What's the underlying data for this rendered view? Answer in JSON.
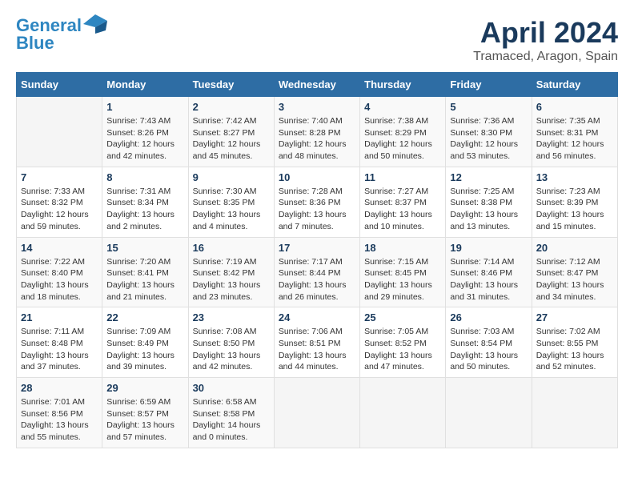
{
  "header": {
    "logo_line1": "General",
    "logo_line2": "Blue",
    "month_year": "April 2024",
    "location": "Tramaced, Aragon, Spain"
  },
  "weekdays": [
    "Sunday",
    "Monday",
    "Tuesday",
    "Wednesday",
    "Thursday",
    "Friday",
    "Saturday"
  ],
  "weeks": [
    [
      {
        "day": "",
        "sunrise": "",
        "sunset": "",
        "daylight": ""
      },
      {
        "day": "1",
        "sunrise": "Sunrise: 7:43 AM",
        "sunset": "Sunset: 8:26 PM",
        "daylight": "Daylight: 12 hours and 42 minutes."
      },
      {
        "day": "2",
        "sunrise": "Sunrise: 7:42 AM",
        "sunset": "Sunset: 8:27 PM",
        "daylight": "Daylight: 12 hours and 45 minutes."
      },
      {
        "day": "3",
        "sunrise": "Sunrise: 7:40 AM",
        "sunset": "Sunset: 8:28 PM",
        "daylight": "Daylight: 12 hours and 48 minutes."
      },
      {
        "day": "4",
        "sunrise": "Sunrise: 7:38 AM",
        "sunset": "Sunset: 8:29 PM",
        "daylight": "Daylight: 12 hours and 50 minutes."
      },
      {
        "day": "5",
        "sunrise": "Sunrise: 7:36 AM",
        "sunset": "Sunset: 8:30 PM",
        "daylight": "Daylight: 12 hours and 53 minutes."
      },
      {
        "day": "6",
        "sunrise": "Sunrise: 7:35 AM",
        "sunset": "Sunset: 8:31 PM",
        "daylight": "Daylight: 12 hours and 56 minutes."
      }
    ],
    [
      {
        "day": "7",
        "sunrise": "Sunrise: 7:33 AM",
        "sunset": "Sunset: 8:32 PM",
        "daylight": "Daylight: 12 hours and 59 minutes."
      },
      {
        "day": "8",
        "sunrise": "Sunrise: 7:31 AM",
        "sunset": "Sunset: 8:34 PM",
        "daylight": "Daylight: 13 hours and 2 minutes."
      },
      {
        "day": "9",
        "sunrise": "Sunrise: 7:30 AM",
        "sunset": "Sunset: 8:35 PM",
        "daylight": "Daylight: 13 hours and 4 minutes."
      },
      {
        "day": "10",
        "sunrise": "Sunrise: 7:28 AM",
        "sunset": "Sunset: 8:36 PM",
        "daylight": "Daylight: 13 hours and 7 minutes."
      },
      {
        "day": "11",
        "sunrise": "Sunrise: 7:27 AM",
        "sunset": "Sunset: 8:37 PM",
        "daylight": "Daylight: 13 hours and 10 minutes."
      },
      {
        "day": "12",
        "sunrise": "Sunrise: 7:25 AM",
        "sunset": "Sunset: 8:38 PM",
        "daylight": "Daylight: 13 hours and 13 minutes."
      },
      {
        "day": "13",
        "sunrise": "Sunrise: 7:23 AM",
        "sunset": "Sunset: 8:39 PM",
        "daylight": "Daylight: 13 hours and 15 minutes."
      }
    ],
    [
      {
        "day": "14",
        "sunrise": "Sunrise: 7:22 AM",
        "sunset": "Sunset: 8:40 PM",
        "daylight": "Daylight: 13 hours and 18 minutes."
      },
      {
        "day": "15",
        "sunrise": "Sunrise: 7:20 AM",
        "sunset": "Sunset: 8:41 PM",
        "daylight": "Daylight: 13 hours and 21 minutes."
      },
      {
        "day": "16",
        "sunrise": "Sunrise: 7:19 AM",
        "sunset": "Sunset: 8:42 PM",
        "daylight": "Daylight: 13 hours and 23 minutes."
      },
      {
        "day": "17",
        "sunrise": "Sunrise: 7:17 AM",
        "sunset": "Sunset: 8:44 PM",
        "daylight": "Daylight: 13 hours and 26 minutes."
      },
      {
        "day": "18",
        "sunrise": "Sunrise: 7:15 AM",
        "sunset": "Sunset: 8:45 PM",
        "daylight": "Daylight: 13 hours and 29 minutes."
      },
      {
        "day": "19",
        "sunrise": "Sunrise: 7:14 AM",
        "sunset": "Sunset: 8:46 PM",
        "daylight": "Daylight: 13 hours and 31 minutes."
      },
      {
        "day": "20",
        "sunrise": "Sunrise: 7:12 AM",
        "sunset": "Sunset: 8:47 PM",
        "daylight": "Daylight: 13 hours and 34 minutes."
      }
    ],
    [
      {
        "day": "21",
        "sunrise": "Sunrise: 7:11 AM",
        "sunset": "Sunset: 8:48 PM",
        "daylight": "Daylight: 13 hours and 37 minutes."
      },
      {
        "day": "22",
        "sunrise": "Sunrise: 7:09 AM",
        "sunset": "Sunset: 8:49 PM",
        "daylight": "Daylight: 13 hours and 39 minutes."
      },
      {
        "day": "23",
        "sunrise": "Sunrise: 7:08 AM",
        "sunset": "Sunset: 8:50 PM",
        "daylight": "Daylight: 13 hours and 42 minutes."
      },
      {
        "day": "24",
        "sunrise": "Sunrise: 7:06 AM",
        "sunset": "Sunset: 8:51 PM",
        "daylight": "Daylight: 13 hours and 44 minutes."
      },
      {
        "day": "25",
        "sunrise": "Sunrise: 7:05 AM",
        "sunset": "Sunset: 8:52 PM",
        "daylight": "Daylight: 13 hours and 47 minutes."
      },
      {
        "day": "26",
        "sunrise": "Sunrise: 7:03 AM",
        "sunset": "Sunset: 8:54 PM",
        "daylight": "Daylight: 13 hours and 50 minutes."
      },
      {
        "day": "27",
        "sunrise": "Sunrise: 7:02 AM",
        "sunset": "Sunset: 8:55 PM",
        "daylight": "Daylight: 13 hours and 52 minutes."
      }
    ],
    [
      {
        "day": "28",
        "sunrise": "Sunrise: 7:01 AM",
        "sunset": "Sunset: 8:56 PM",
        "daylight": "Daylight: 13 hours and 55 minutes."
      },
      {
        "day": "29",
        "sunrise": "Sunrise: 6:59 AM",
        "sunset": "Sunset: 8:57 PM",
        "daylight": "Daylight: 13 hours and 57 minutes."
      },
      {
        "day": "30",
        "sunrise": "Sunrise: 6:58 AM",
        "sunset": "Sunset: 8:58 PM",
        "daylight": "Daylight: 14 hours and 0 minutes."
      },
      {
        "day": "",
        "sunrise": "",
        "sunset": "",
        "daylight": ""
      },
      {
        "day": "",
        "sunrise": "",
        "sunset": "",
        "daylight": ""
      },
      {
        "day": "",
        "sunrise": "",
        "sunset": "",
        "daylight": ""
      },
      {
        "day": "",
        "sunrise": "",
        "sunset": "",
        "daylight": ""
      }
    ]
  ]
}
